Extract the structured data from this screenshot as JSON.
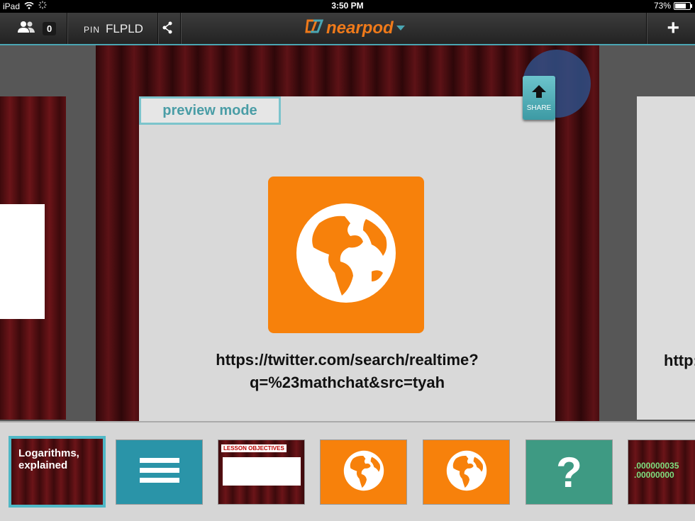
{
  "status_bar": {
    "device": "iPad",
    "time": "3:50 PM",
    "battery": "73%",
    "battery_level": 0.73
  },
  "toolbar": {
    "participant_count": "0",
    "pin_label": "PIN",
    "pin_code": "FLPLD",
    "brand": "nearpod",
    "icons": {
      "users": "users-icon",
      "share": "share-icon",
      "add": "plus-icon",
      "menu": "chevron-down-icon"
    }
  },
  "slide": {
    "preview_label": "preview mode",
    "share_label": "SHARE",
    "url_line1": "https://twitter.com/search/realtime?",
    "url_line2": "q=%23mathchat&src=tyah",
    "next_peek": "http:"
  },
  "filmstrip": {
    "thumbnails": [
      {
        "kind": "title",
        "title_line1": "Logarithms,",
        "title_line2": "explained",
        "selected": true
      },
      {
        "kind": "menu"
      },
      {
        "kind": "objectives",
        "title": "LESSON OBJECTIVES"
      },
      {
        "kind": "web"
      },
      {
        "kind": "web"
      },
      {
        "kind": "quiz",
        "symbol": "?"
      },
      {
        "kind": "slide",
        "digits": ".000000035\n.00000000"
      }
    ]
  },
  "colors": {
    "accent": "#4fb8c6",
    "brand_orange": "#f7810b",
    "curtain_red": "#6b1418"
  }
}
